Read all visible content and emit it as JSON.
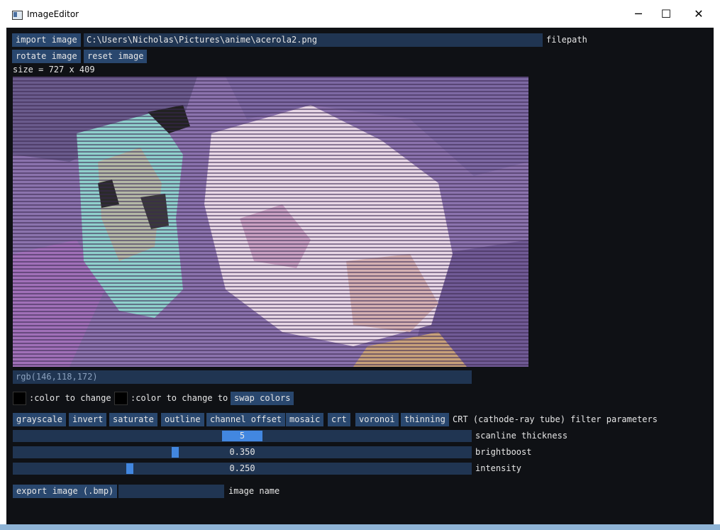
{
  "window": {
    "title": "ImageEditor",
    "min_icon": "─",
    "max_icon": "☐",
    "close_icon": "✕"
  },
  "toolbar": {
    "import_label": "import image",
    "filepath_value": "C:\\Users\\Nicholas\\Pictures\\anime\\acerola2.png",
    "filepath_label": "filepath",
    "rotate_label": "rotate image",
    "reset_label": "reset image",
    "size_text": "size = 727 x 409"
  },
  "pixel_readout": "rgb(146,118,172)",
  "swap": {
    "from_label": ":color to change",
    "to_label": ":color to change to",
    "swap_label": "swap colors",
    "from_color": "#000000",
    "to_color": "#000000"
  },
  "filters": {
    "items": [
      "grayscale",
      "invert",
      "saturate",
      "outline",
      "channel offset",
      "mosaic",
      "crt",
      "voronoi",
      "thinning"
    ],
    "params_title": "CRT (cathode-ray tube) filter parameters"
  },
  "params": {
    "scanline": {
      "label": "scanline thickness",
      "value": "5",
      "fraction": 0.5
    },
    "brightboost": {
      "label": "brightboost",
      "value": "0.350",
      "fraction": 0.35
    },
    "intensity": {
      "label": "intensity",
      "value": "0.250",
      "fraction": 0.25
    }
  },
  "export": {
    "button_label": "export image (.bmp)",
    "name_value": "",
    "name_label": "image name"
  },
  "colors": {
    "accent": "#4287e0",
    "button": "#29476e",
    "field": "#203552",
    "background": "#0f1115"
  }
}
